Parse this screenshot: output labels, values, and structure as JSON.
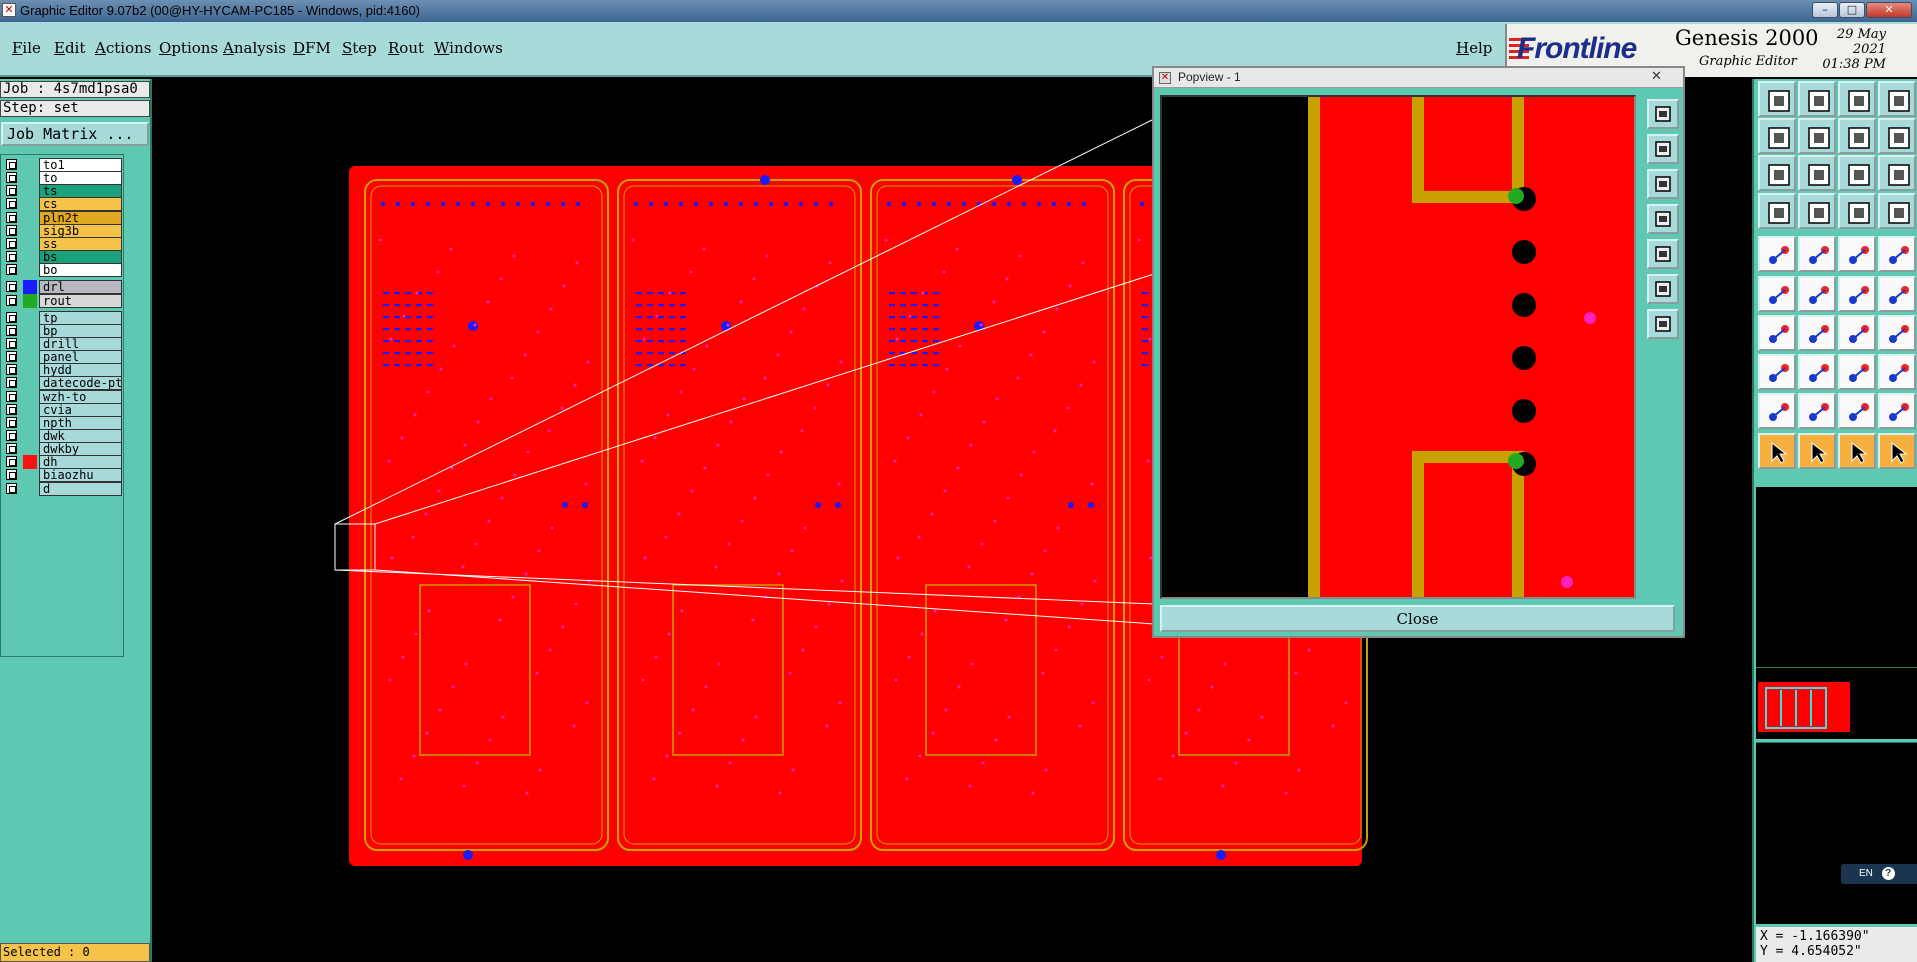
{
  "window": {
    "title": "Graphic Editor 9.07b2 (00@HY-HYCAM-PC185 - Windows, pid:4160)",
    "controls": {
      "minimize": "–",
      "maximize": "□",
      "close": "✕"
    }
  },
  "menu": {
    "items": [
      "File",
      "Edit",
      "Actions",
      "Options",
      "Analysis",
      "DFM",
      "Step",
      "Rout",
      "Windows"
    ],
    "help": "Help"
  },
  "brand": {
    "logo": "Frontline",
    "product": "Genesis 2000",
    "subtitle": "Graphic Editor",
    "date": "29 May 2021",
    "time": "01:38 PM"
  },
  "left": {
    "job": "Job : 4s7md1psa0",
    "step": "Step: set",
    "job_matrix": "Job Matrix ...",
    "layers": [
      {
        "name": "to1",
        "name_bg": "#ffffff",
        "swatch": null
      },
      {
        "name": "to",
        "name_bg": "#ffffff",
        "swatch": null
      },
      {
        "name": "ts",
        "name_bg": "#1aa07a",
        "swatch": null
      },
      {
        "name": "cs",
        "name_bg": "#f5c24a",
        "swatch": null
      },
      {
        "name": "pln2t",
        "name_bg": "#e0a820",
        "swatch": null
      },
      {
        "name": "sig3b",
        "name_bg": "#f5c24a",
        "swatch": null
      },
      {
        "name": "ss",
        "name_bg": "#f5c24a",
        "swatch": null
      },
      {
        "name": "bs",
        "name_bg": "#1aa07a",
        "swatch": null
      },
      {
        "name": "bo",
        "name_bg": "#ffffff",
        "swatch": null
      },
      {
        "name": "drl",
        "name_bg": "#b8b8c0",
        "swatch": "#1a1aff"
      },
      {
        "name": "rout",
        "name_bg": "#d8d8d8",
        "swatch": "#22aa22"
      },
      {
        "name": "tp",
        "name_bg": "#a8dada",
        "swatch": null
      },
      {
        "name": "bp",
        "name_bg": "#a8dada",
        "swatch": null
      },
      {
        "name": "drill",
        "name_bg": "#a8dada",
        "swatch": null
      },
      {
        "name": "panel",
        "name_bg": "#a8dada",
        "swatch": null
      },
      {
        "name": "hydd",
        "name_bg": "#a8dada",
        "swatch": null
      },
      {
        "name": "datecode-pte",
        "name_bg": "#a8dada",
        "swatch": null
      },
      {
        "name": "wzh-to",
        "name_bg": "#a8dada",
        "swatch": null
      },
      {
        "name": "cvia",
        "name_bg": "#a8dada",
        "swatch": null
      },
      {
        "name": "npth",
        "name_bg": "#a8dada",
        "swatch": null
      },
      {
        "name": "dwk",
        "name_bg": "#a8dada",
        "swatch": null
      },
      {
        "name": "dwkby",
        "name_bg": "#a8dada",
        "swatch": null
      },
      {
        "name": "dh",
        "name_bg": "#a8dada",
        "swatch": "#ff1010"
      },
      {
        "name": "biaozhu",
        "name_bg": "#a8dada",
        "swatch": null
      },
      {
        "name": "d",
        "name_bg": "#a8dada",
        "swatch": null
      }
    ],
    "selected": "Selected : 0"
  },
  "popview": {
    "title": "Popview - 1",
    "close_x": "✕",
    "close_button": "Close"
  },
  "status": {
    "x": "X = -1.166390\"",
    "y": "Y = 4.654052\"",
    "ime": "EN"
  },
  "colors": {
    "board": "#ff0000",
    "trace": "#c8a000",
    "drill": "#1a1aff",
    "pad": "#ff20c0",
    "accent": "#5ec8b0"
  }
}
